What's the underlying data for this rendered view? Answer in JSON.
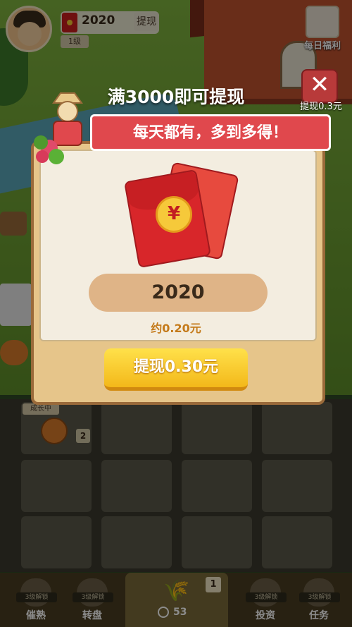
{
  "header": {
    "coin_value": "2020",
    "withdraw_label": "提现",
    "level_label": "1级"
  },
  "daily_welfare": {
    "label": "每日福利",
    "icon": "gift-box-icon"
  },
  "close": {
    "symbol": "✕",
    "caption": "提现0.3元"
  },
  "modal": {
    "headline": "满3000即可提现",
    "ribbon": "每天都有，多到多得！",
    "amount": "2020",
    "approx_value": "约0.20元",
    "cash_button": "提现0.30元",
    "yen_symbol": "¥"
  },
  "grid": {
    "status_label": "成长中",
    "crop_count": "2"
  },
  "bottom_nav": {
    "center_count": "53",
    "center_badge": "1",
    "center_icon": "wheat-icon",
    "items": [
      {
        "label": "催熟",
        "unlock": "3级解锁",
        "icon": "speedup-icon"
      },
      {
        "label": "转盘",
        "unlock": "3级解锁",
        "icon": "wheel-icon"
      },
      {
        "label": "投资",
        "unlock": "3级解锁",
        "icon": "invest-icon"
      },
      {
        "label": "任务",
        "unlock": "3级解锁",
        "icon": "task-icon"
      }
    ]
  },
  "colors": {
    "ribbon_red": "#e0484d",
    "button_yellow": "#f3b81a",
    "modal_wood": "#e6c58a"
  }
}
